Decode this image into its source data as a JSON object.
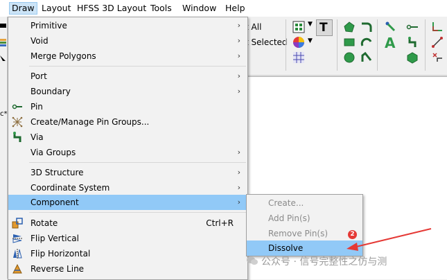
{
  "menubar": {
    "items": [
      "Draw",
      "Layout",
      "HFSS 3D Layout",
      "Tools",
      "Window",
      "Help"
    ]
  },
  "toolbar": {
    "select_all_partial": "t All",
    "selected_partial": "t Selected"
  },
  "left_partial": "c*",
  "draw_menu": {
    "items": [
      {
        "label": "Primitive",
        "submenu": true
      },
      {
        "label": "Void",
        "submenu": true
      },
      {
        "label": "Merge Polygons",
        "submenu": true
      },
      {
        "label": "Port",
        "submenu": true
      },
      {
        "label": "Boundary",
        "submenu": true
      },
      {
        "label": "Pin",
        "icon": "pin-icon"
      },
      {
        "label": "Create/Manage Pin Groups...",
        "icon": "pin-groups-icon"
      },
      {
        "label": "Via",
        "icon": "via-icon"
      },
      {
        "label": "Via Groups",
        "submenu": true
      },
      {
        "label": "3D Structure",
        "submenu": true
      },
      {
        "label": "Coordinate System",
        "submenu": true
      },
      {
        "label": "Component",
        "submenu": true,
        "highlighted": true
      },
      {
        "label": "Rotate",
        "shortcut": "Ctrl+R",
        "icon": "rotate-icon"
      },
      {
        "label": "Flip Vertical",
        "icon": "flip-vertical-icon"
      },
      {
        "label": "Flip Horizontal",
        "icon": "flip-horizontal-icon"
      },
      {
        "label": "Reverse Line",
        "icon": "reverse-line-icon"
      }
    ]
  },
  "component_submenu": {
    "items": [
      {
        "label": "Create...",
        "enabled": false
      },
      {
        "label": "Add Pin(s)",
        "enabled": false
      },
      {
        "label": "Remove Pin(s)",
        "enabled": false
      },
      {
        "label": "Dissolve",
        "enabled": true,
        "highlighted": true
      }
    ]
  },
  "annotation": {
    "badge": "2",
    "arrow_color": "#e53935"
  },
  "watermark": "公众号 · 信号完整性之仿与测",
  "colors": {
    "menu_highlight": "#91c9f7",
    "menubar_active": "#cce4f7",
    "disabled_text": "#8a8a8a"
  }
}
